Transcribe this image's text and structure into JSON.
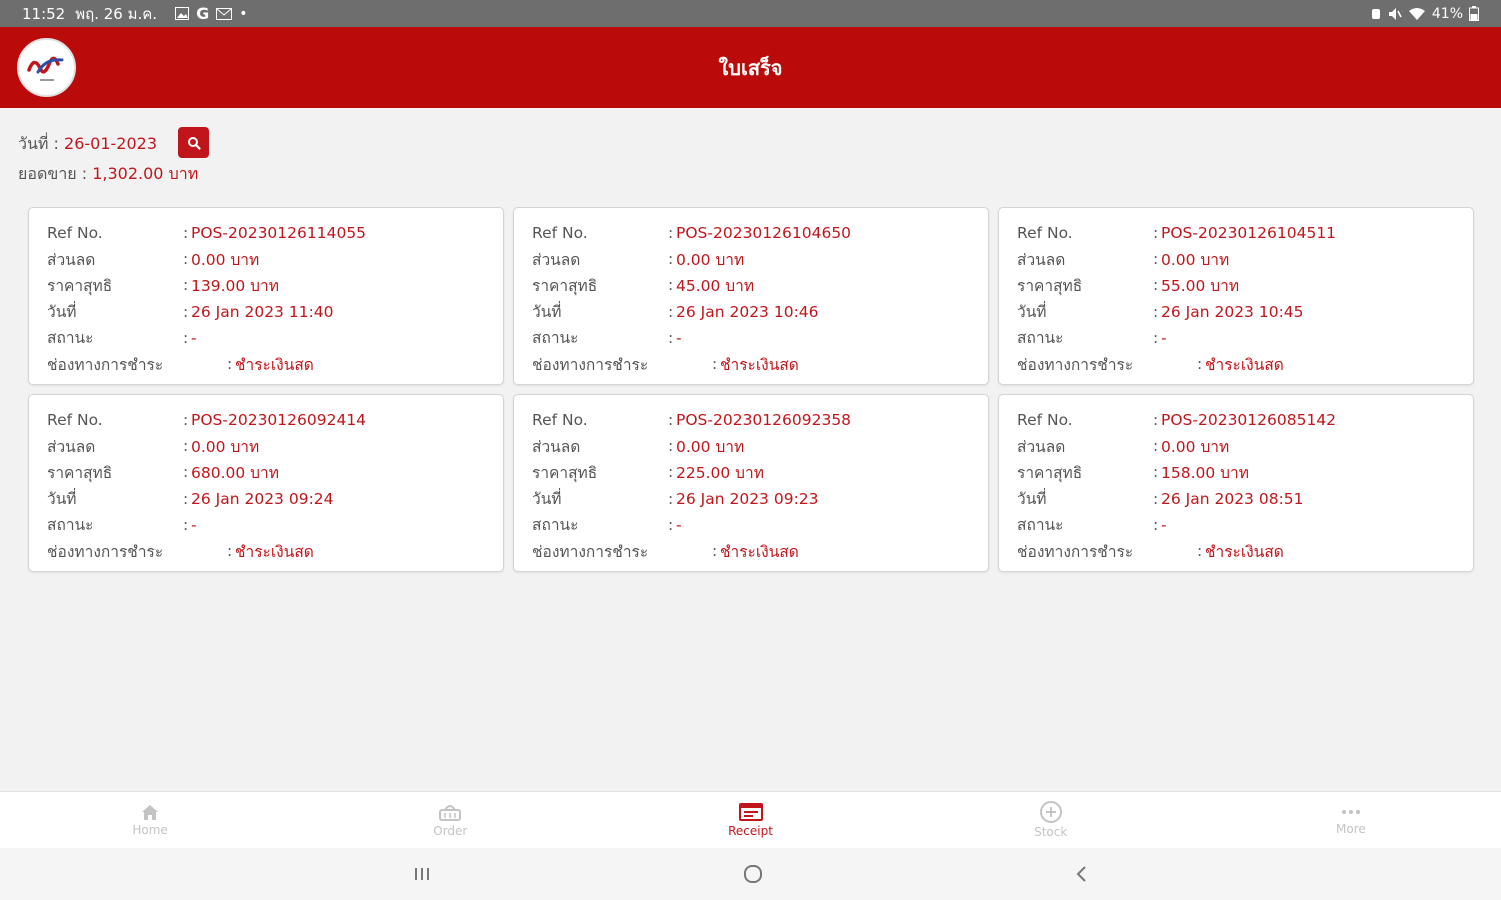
{
  "status_bar": {
    "time": "11:52",
    "date": "พฤ. 26 ม.ค.",
    "battery": "41%"
  },
  "header": {
    "title": "ใบเสร็จ"
  },
  "summary": {
    "date_label": "วันที่ : ",
    "date_value": "26-01-2023",
    "sales_label": "ยอดขาย : ",
    "sales_value": "1,302.00 บาท"
  },
  "labels": {
    "ref": "Ref No.",
    "discount": "ส่วนลด",
    "net": "ราคาสุทธิ",
    "date": "วันที่",
    "status": "สถานะ",
    "payment": "ช่องทางการชำระ"
  },
  "receipts": [
    {
      "ref": "POS-20230126114055",
      "discount": "0.00 บาท",
      "net": "139.00 บาท",
      "date": "26 Jan 2023 11:40",
      "status": "-",
      "payment": "ชำระเงินสด"
    },
    {
      "ref": "POS-20230126104650",
      "discount": "0.00 บาท",
      "net": "45.00 บาท",
      "date": "26 Jan 2023 10:46",
      "status": "-",
      "payment": "ชำระเงินสด"
    },
    {
      "ref": "POS-20230126104511",
      "discount": "0.00 บาท",
      "net": "55.00 บาท",
      "date": "26 Jan 2023 10:45",
      "status": "-",
      "payment": "ชำระเงินสด"
    },
    {
      "ref": "POS-20230126092414",
      "discount": "0.00 บาท",
      "net": "680.00 บาท",
      "date": "26 Jan 2023 09:24",
      "status": "-",
      "payment": "ชำระเงินสด"
    },
    {
      "ref": "POS-20230126092358",
      "discount": "0.00 บาท",
      "net": "225.00 บาท",
      "date": "26 Jan 2023 09:23",
      "status": "-",
      "payment": "ชำระเงินสด"
    },
    {
      "ref": "POS-20230126085142",
      "discount": "0.00 บาท",
      "net": "158.00 บาท",
      "date": "26 Jan 2023 08:51",
      "status": "-",
      "payment": "ชำระเงินสด"
    }
  ],
  "nav": [
    {
      "label": "Home",
      "icon": "home-icon"
    },
    {
      "label": "Order",
      "icon": "basket-icon"
    },
    {
      "label": "Receipt",
      "icon": "receipt-icon",
      "active": true
    },
    {
      "label": "Stock",
      "icon": "stock-icon"
    },
    {
      "label": "More",
      "icon": "more-icon"
    }
  ],
  "colors": {
    "brand": "#bb0a0a",
    "accent": "#c0161b",
    "inactive": "#c4c4c4"
  }
}
